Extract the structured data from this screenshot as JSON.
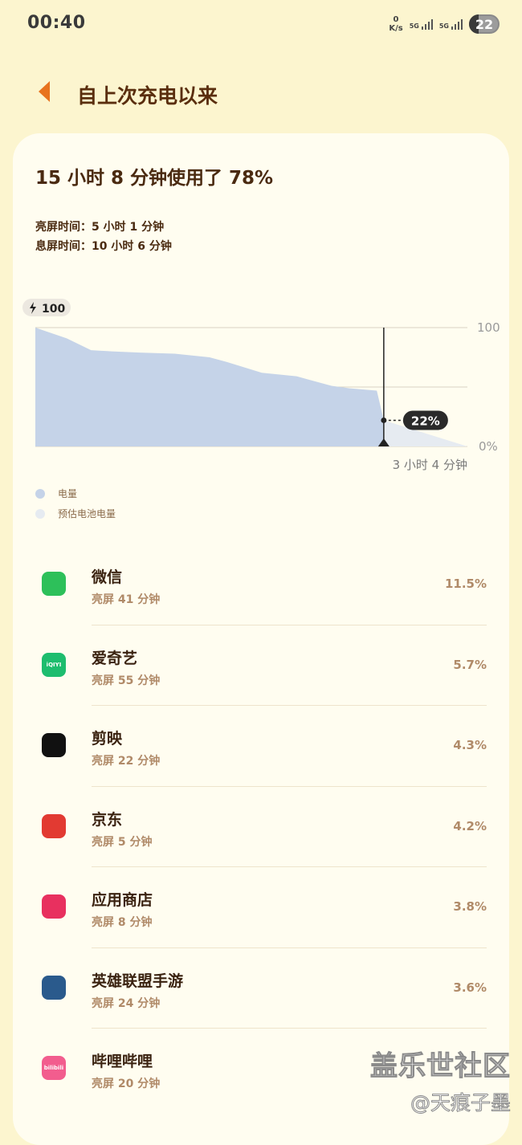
{
  "status_bar": {
    "time": "00:40",
    "net_speed_value": "0",
    "net_speed_unit": "K/s",
    "sim1_label": "5G",
    "sim2_label": "5G",
    "battery_level": "22"
  },
  "header": {
    "back_icon": "back-arrow-icon",
    "title": "自上次充电以来"
  },
  "summary": {
    "headline": "15 小时 8 分钟使用了 78%",
    "screen_on": "亮屏时间：5 小时 1 分钟",
    "screen_off": "息屏时间：10 小时 6 分钟"
  },
  "chart_data": {
    "type": "area",
    "start_badge": "100",
    "y_labels": [
      "100",
      "0%"
    ],
    "ylim": [
      0,
      100
    ],
    "current_level_label": "22%",
    "current_level": 22,
    "estimate_label": "3 小时 4 分钟",
    "series": [
      {
        "name": "电量",
        "color": "#c5d3e8",
        "x": [
          0,
          3,
          9,
          16,
          22,
          30,
          40,
          50,
          55,
          65,
          75,
          80,
          85,
          90,
          98,
          100
        ],
        "values": [
          100,
          97,
          91,
          81,
          80,
          79,
          78,
          75,
          71,
          62,
          59,
          55,
          51,
          49,
          47,
          22
        ]
      },
      {
        "name": "预估电池电量",
        "color": "#e6ebf1",
        "x": [
          100,
          124
        ],
        "values": [
          22,
          0
        ]
      }
    ],
    "legend": [
      {
        "label": "电量",
        "color": "#c5d3e8"
      },
      {
        "label": "预估电池电量",
        "color": "#e6ebf1"
      }
    ]
  },
  "apps": [
    {
      "name": "微信",
      "screen_time": "亮屏 41 分钟",
      "percent": "11.5%",
      "icon": "wechat-icon",
      "color": "#2dc05a"
    },
    {
      "name": "爱奇艺",
      "screen_time": "亮屏 55 分钟",
      "percent": "5.7%",
      "icon": "iqiyi-icon",
      "color": "#1dbd6e",
      "icon_text": "iQIYI"
    },
    {
      "name": "剪映",
      "screen_time": "亮屏 22 分钟",
      "percent": "4.3%",
      "icon": "capcut-icon",
      "color": "#111111"
    },
    {
      "name": "京东",
      "screen_time": "亮屏 5 分钟",
      "percent": "4.2%",
      "icon": "jd-icon",
      "color": "#e23a32"
    },
    {
      "name": "应用商店",
      "screen_time": "亮屏 8 分钟",
      "percent": "3.8%",
      "icon": "app-store-icon",
      "color": "#e8305f"
    },
    {
      "name": "英雄联盟手游",
      "screen_time": "亮屏 24 分钟",
      "percent": "3.6%",
      "icon": "lol-icon",
      "color": "#2a5a8c"
    },
    {
      "name": "哔哩哔哩",
      "screen_time": "亮屏 20 分钟",
      "percent": "",
      "icon": "bilibili-icon",
      "color": "#f25d8e",
      "icon_text": "bilibili"
    }
  ],
  "watermark": {
    "line1": "盖乐世社区",
    "line2": "@天痕子墨"
  }
}
